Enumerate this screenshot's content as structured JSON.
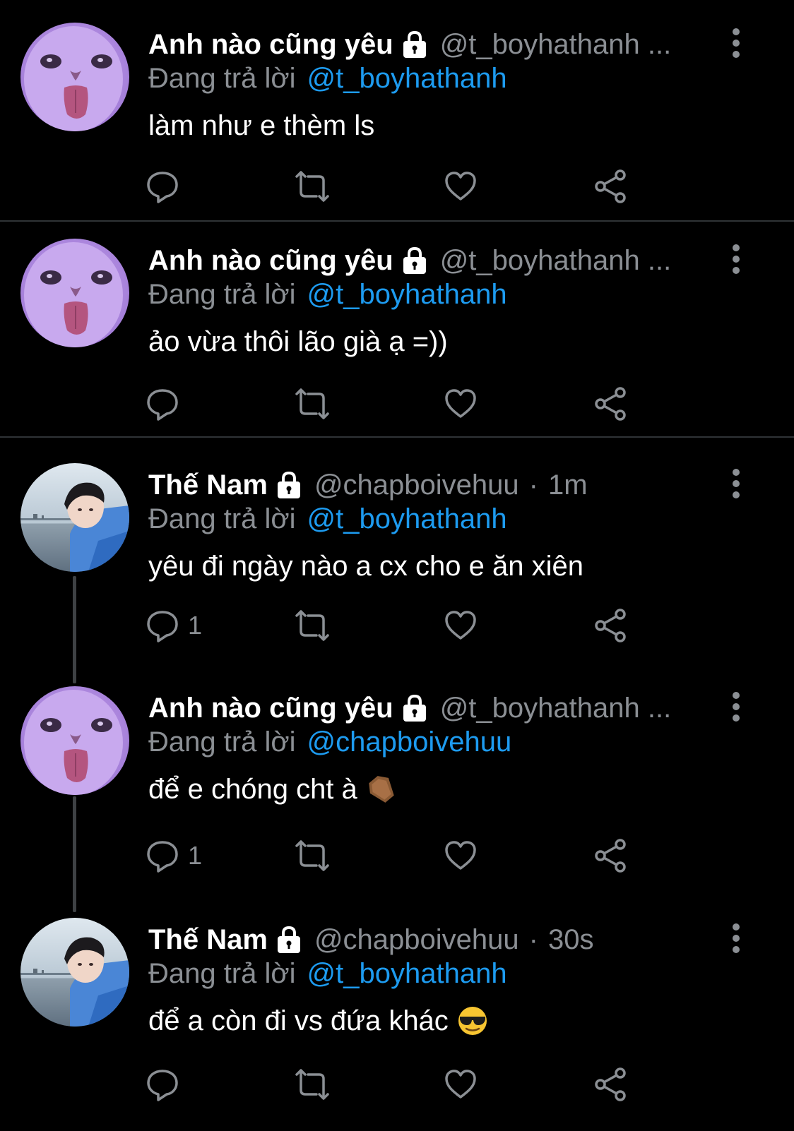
{
  "colors": {
    "background": "#000000",
    "name": "#ffffff",
    "muted": "#8b8f94",
    "link": "#1d9bf0",
    "divider": "#2f3336"
  },
  "tweets": [
    {
      "display_name": "Anh nào cũng yêu",
      "lock_icon": "lock-icon",
      "handle": "@t_boyhathanh ...",
      "time": "",
      "reply_prefix": "Đang trả lời",
      "reply_to": "@t_boyhathanh",
      "text": "làm như e thèm ls",
      "emoji": "",
      "reply_count": "",
      "avatar": "purple-cat"
    },
    {
      "display_name": "Anh nào cũng yêu",
      "lock_icon": "lock-icon",
      "handle": "@t_boyhathanh ...",
      "time": "",
      "reply_prefix": "Đang trả lời",
      "reply_to": "@t_boyhathanh",
      "text": "ảo vừa thôi lão già ạ =))",
      "emoji": "",
      "reply_count": "",
      "avatar": "purple-cat"
    },
    {
      "display_name": "Thế Nam",
      "lock_icon": "lock-icon",
      "handle": "@chapboivehuu",
      "time": "1m",
      "reply_prefix": "Đang trả lời",
      "reply_to": "@t_boyhathanh",
      "text": "yêu đi ngày nào a cx cho e ăn xiên",
      "emoji": "",
      "reply_count": "1",
      "avatar": "boy-sea"
    },
    {
      "display_name": "Anh nào cũng yêu",
      "lock_icon": "lock-icon",
      "handle": "@t_boyhathanh ...",
      "time": "",
      "reply_prefix": "Đang trả lời",
      "reply_to": "@chapboivehuu",
      "text": "để e chóng cht à",
      "emoji": "coffin-emoji",
      "reply_count": "1",
      "avatar": "purple-cat"
    },
    {
      "display_name": "Thế Nam",
      "lock_icon": "lock-icon",
      "handle": "@chapboivehuu",
      "time": "30s",
      "reply_prefix": "Đang trả lời",
      "reply_to": "@t_boyhathanh",
      "text": "để a còn đi vs đứa khác",
      "emoji": "sunglasses-emoji",
      "reply_count": "",
      "avatar": "boy-sea"
    }
  ],
  "action_icons": [
    "reply-icon",
    "retweet-icon",
    "like-icon",
    "share-icon"
  ],
  "more_icon": "more-vertical-icon"
}
